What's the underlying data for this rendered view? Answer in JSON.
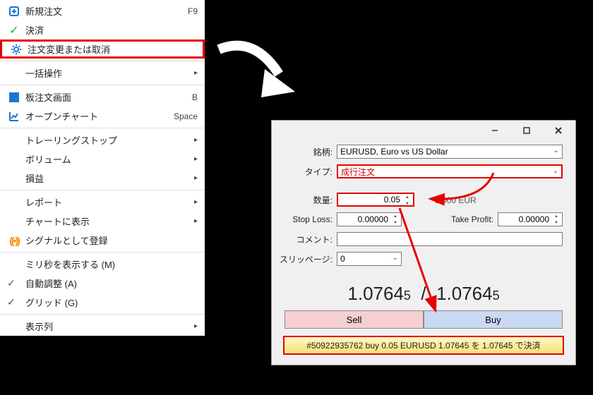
{
  "menu": {
    "items": [
      {
        "icon": "new-order",
        "label": "新規注文",
        "hotkey": "F9"
      },
      {
        "icon": "check-green",
        "label": "決済",
        "hotkey": ""
      },
      {
        "icon": "gear",
        "label": "注文変更または取消",
        "hotkey": ""
      },
      {
        "icon": "",
        "label": "一括操作",
        "hotkey": "",
        "sub": true
      },
      {
        "icon": "depth",
        "label": "板注文画面",
        "hotkey": "B"
      },
      {
        "icon": "chart",
        "label": "オープンチャート",
        "hotkey": "Space"
      },
      {
        "icon": "",
        "label": "トレーリングストップ",
        "hotkey": "",
        "sub": true
      },
      {
        "icon": "",
        "label": "ボリューム",
        "hotkey": "",
        "sub": true
      },
      {
        "icon": "",
        "label": "損益",
        "hotkey": "",
        "sub": true
      },
      {
        "icon": "",
        "label": "レポート",
        "hotkey": "",
        "sub": true
      },
      {
        "icon": "",
        "label": "チャートに表示",
        "hotkey": "",
        "sub": true
      },
      {
        "icon": "signal",
        "label": "シグナルとして登録",
        "hotkey": ""
      },
      {
        "icon": "",
        "label": "ミリ秒を表示する (M)",
        "hotkey": ""
      },
      {
        "icon": "check",
        "label": "自動調整 (A)",
        "hotkey": ""
      },
      {
        "icon": "check",
        "label": "グリッド (G)",
        "hotkey": ""
      },
      {
        "icon": "",
        "label": "表示列",
        "hotkey": "",
        "sub": true
      }
    ]
  },
  "dialog": {
    "labels": {
      "symbol": "銘柄:",
      "type": "タイプ:",
      "volume": "数量:",
      "sl": "Stop Loss:",
      "tp": "Take Profit:",
      "comment": "コメント:",
      "slippage": "スリッページ:"
    },
    "symbol_value": "EURUSD, Euro vs US Dollar",
    "type_value": "成行注文",
    "volume_value": "0.05",
    "volume_extra": "5 000 EUR",
    "sl_value": "0.00000",
    "tp_value": "0.00000",
    "comment_value": "",
    "slippage_value": "0",
    "bid": "1.0764",
    "bid_d": "5",
    "ask": "1.0764",
    "ask_d": "5",
    "sell_label": "Sell",
    "buy_label": "Buy",
    "status": "#50922935762 buy 0.05 EURUSD 1.07645 を 1.07645 で決済"
  }
}
